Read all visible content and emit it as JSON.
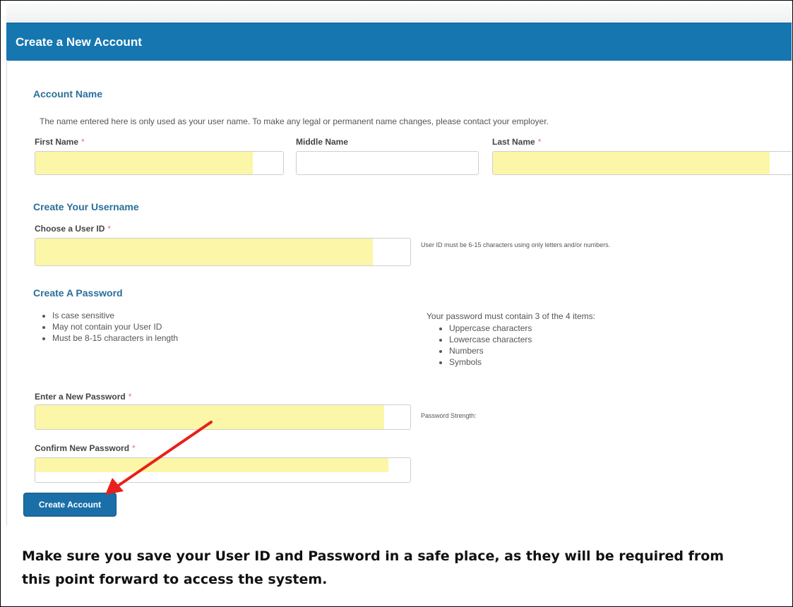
{
  "header": {
    "title": "Create a New Account"
  },
  "account_name": {
    "title": "Account Name",
    "help": "The name entered here is only used as your user name. To make any legal or permanent name changes, please contact your employer.",
    "first_name_label": "First Name",
    "middle_name_label": "Middle Name",
    "last_name_label": "Last Name",
    "required_mark": "*"
  },
  "username": {
    "title": "Create Your Username",
    "user_id_label": "Choose a User ID",
    "hint": "User ID must be 6-15 characters using only letters and/or numbers."
  },
  "password": {
    "title": "Create A Password",
    "rules": [
      "Is case sensitive",
      "May not contain your User ID",
      "Must be 8-15 characters in length"
    ],
    "contain_label": "Your password must contain 3 of the 4 items:",
    "items": [
      "Uppercase characters",
      "Lowercase characters",
      "Numbers",
      "Symbols"
    ],
    "new_label": "Enter a New Password",
    "strength_label": "Password Strength:",
    "confirm_label": "Confirm New Password"
  },
  "actions": {
    "create_label": "Create Account"
  },
  "note": "Make sure you save your User ID and Password in a safe place, as they will be required from this point forward to access the system.",
  "colors": {
    "header": "#1576b0",
    "section_title": "#2a6f99",
    "highlight": "#fbf6a8",
    "arrow": "#e8201c",
    "button": "#1a6fa8"
  }
}
